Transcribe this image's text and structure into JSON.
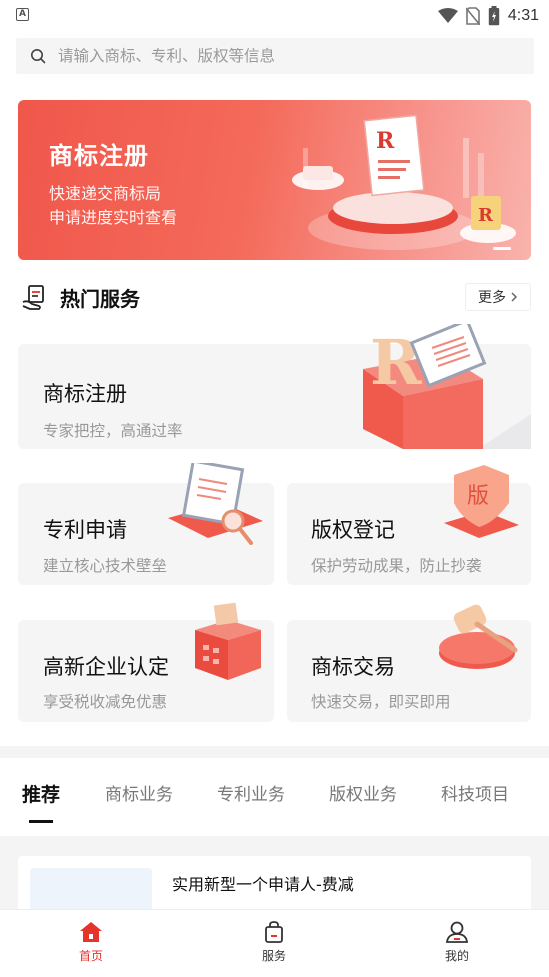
{
  "status_bar": {
    "time": "4:31"
  },
  "search": {
    "placeholder": "请输入商标、专利、版权等信息"
  },
  "banner": {
    "title": "商标注册",
    "line1": "快速递交商标局",
    "line2": "申请进度实时查看"
  },
  "hot_services": {
    "title": "热门服务",
    "more_label": "更多",
    "cards": [
      {
        "title": "商标注册",
        "subtitle": "专家把控，高通过率"
      },
      {
        "title": "专利申请",
        "subtitle": "建立核心技术壁垒"
      },
      {
        "title": "版权登记",
        "subtitle": "保护劳动成果，防止抄袭"
      },
      {
        "title": "高新企业认定",
        "subtitle": "享受税收减免优惠"
      },
      {
        "title": "商标交易",
        "subtitle": "快速交易，即买即用"
      }
    ]
  },
  "tabs": [
    "推荐",
    "商标业务",
    "专利业务",
    "版权业务",
    "科技项目"
  ],
  "list": {
    "items": [
      {
        "title": "实用新型一个申请人-费减"
      }
    ]
  },
  "bottom_nav": [
    {
      "label": "首页",
      "icon": "home-icon"
    },
    {
      "label": "服务",
      "icon": "bag-icon"
    },
    {
      "label": "我的",
      "icon": "user-icon"
    }
  ],
  "colors": {
    "accent": "#e5342b",
    "banner": "#f0574b"
  }
}
